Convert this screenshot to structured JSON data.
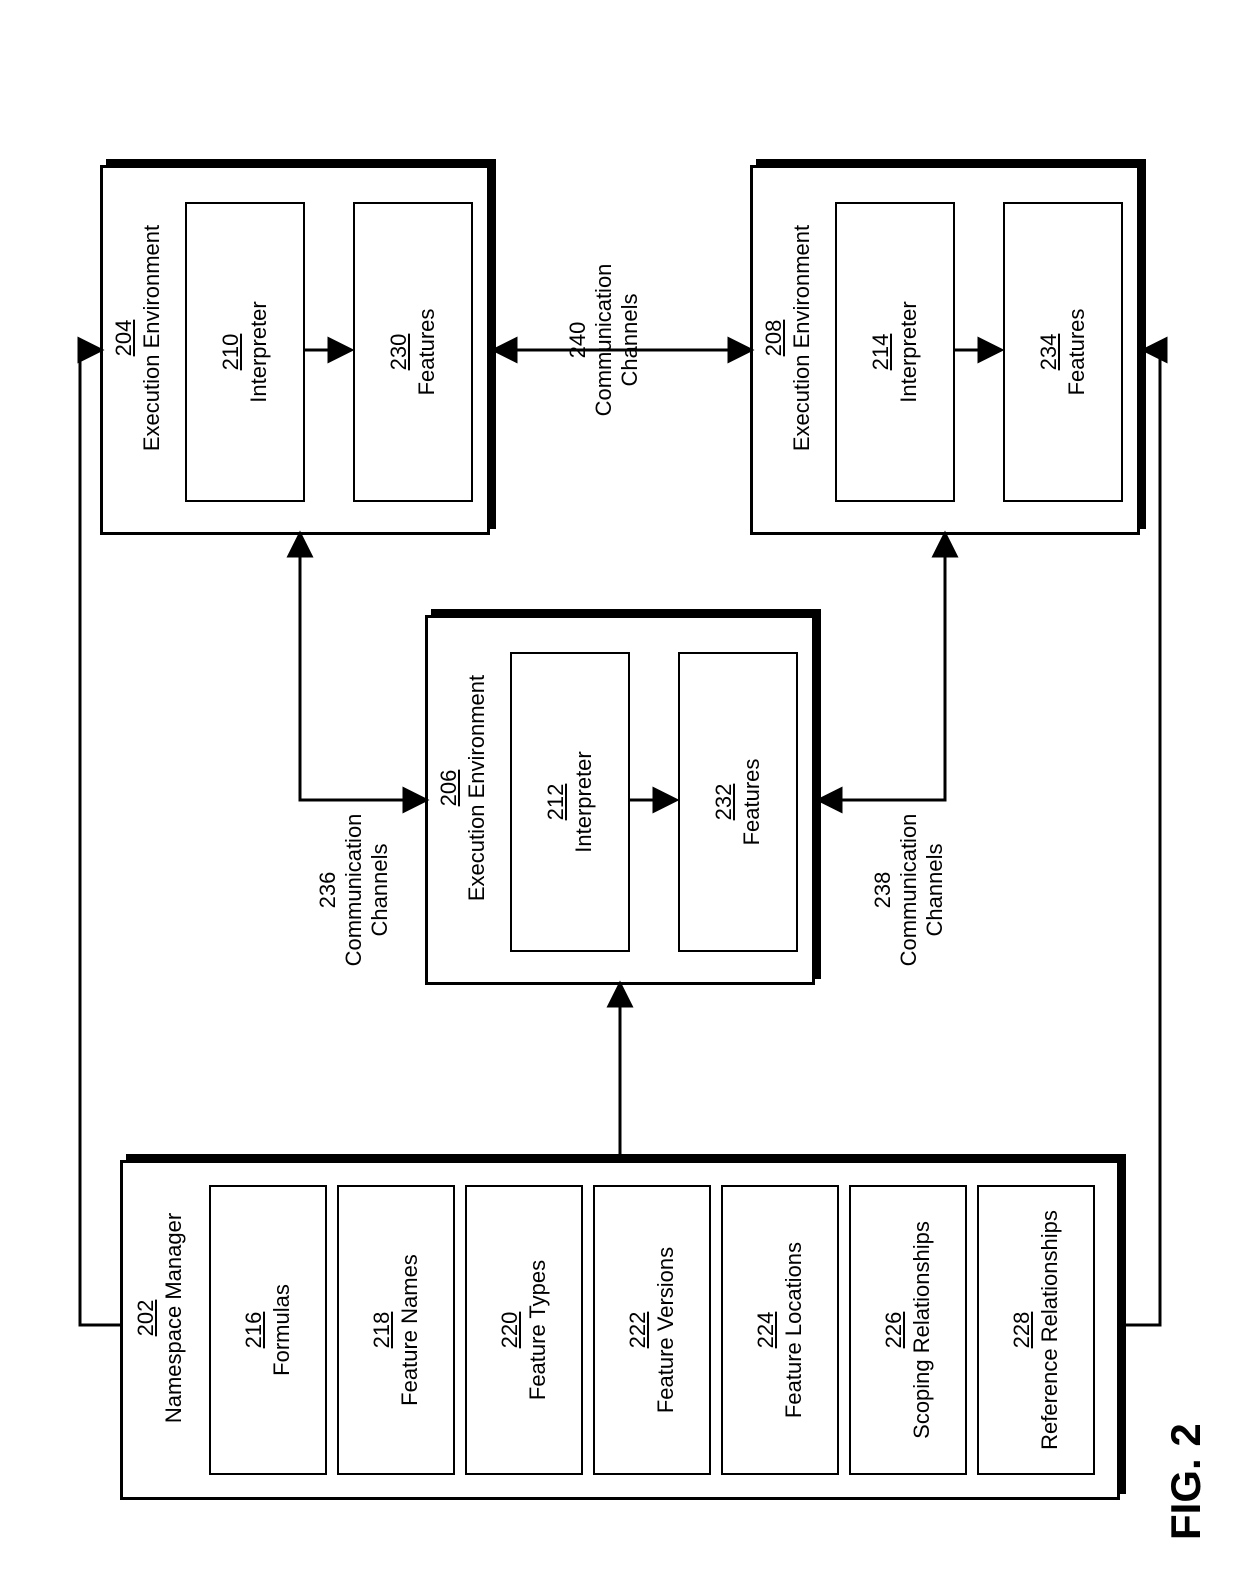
{
  "figure_label": "FIG. 2",
  "namespace": {
    "ref": "202",
    "title": "Namespace Manager",
    "items": [
      {
        "ref": "216",
        "label": "Formulas"
      },
      {
        "ref": "218",
        "label": "Feature Names"
      },
      {
        "ref": "220",
        "label": "Feature Types"
      },
      {
        "ref": "222",
        "label": "Feature Versions"
      },
      {
        "ref": "224",
        "label": "Feature Locations"
      },
      {
        "ref": "226",
        "label": "Scoping Relationships"
      },
      {
        "ref": "228",
        "label": "Reference Relationships"
      }
    ]
  },
  "env": [
    {
      "ref": "204",
      "title": "Execution Environment",
      "interpreter": {
        "ref": "210",
        "label": "Interpreter"
      },
      "features": {
        "ref": "230",
        "label": "Features"
      }
    },
    {
      "ref": "206",
      "title": "Execution Environment",
      "interpreter": {
        "ref": "212",
        "label": "Interpreter"
      },
      "features": {
        "ref": "232",
        "label": "Features"
      }
    },
    {
      "ref": "208",
      "title": "Execution Environment",
      "interpreter": {
        "ref": "214",
        "label": "Interpreter"
      },
      "features": {
        "ref": "234",
        "label": "Features"
      }
    }
  ],
  "channels": [
    {
      "ref": "236",
      "label": "Communication\nChannels"
    },
    {
      "ref": "238",
      "label": "Communication\nChannels"
    },
    {
      "ref": "240",
      "label": "Communication\nChannels"
    }
  ]
}
